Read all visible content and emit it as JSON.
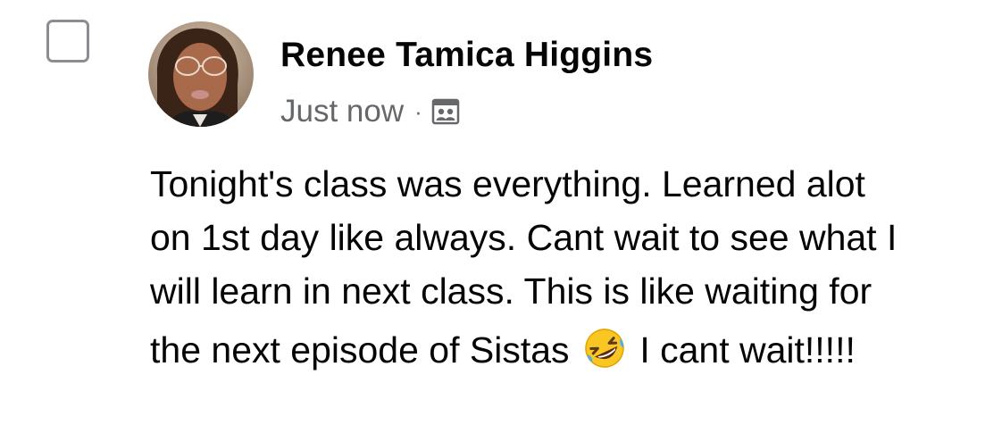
{
  "post": {
    "author_name": "Renee Tamica Higgins",
    "timestamp": "Just now",
    "separator": "·",
    "privacy_icon": "group-members-icon",
    "text_lines": [
      "Tonight's class was everything. Learned alot",
      "on 1st day like always. Cant wait to see what I",
      "will learn in next class. This is like waiting for"
    ],
    "last_line_before_emoji": "the next episode of Sistas",
    "emoji": "rolling-on-the-floor-laughing-emoji",
    "last_line_after_emoji": "I cant wait!!!!!"
  },
  "colors": {
    "text_primary": "#050505",
    "text_secondary": "#65676b",
    "checkbox_border": "#8a8d91",
    "background": "#ffffff"
  }
}
